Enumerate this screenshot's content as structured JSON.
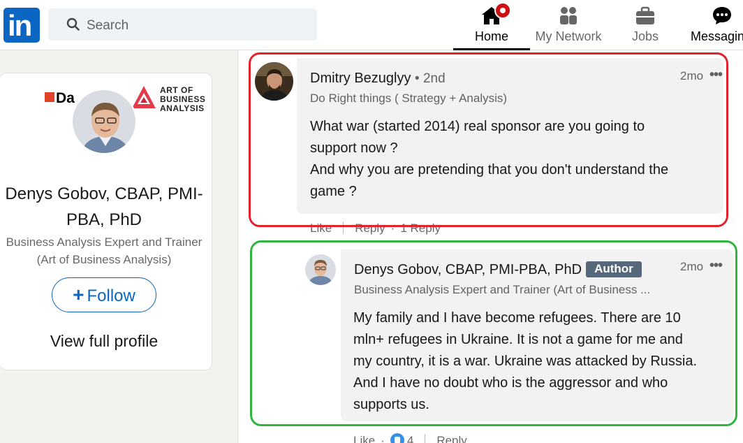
{
  "nav": {
    "logo_text": "in",
    "search_placeholder": "Search",
    "items": [
      {
        "label": "Home",
        "icon": "home-icon",
        "active": true
      },
      {
        "label": "My Network",
        "icon": "people-icon"
      },
      {
        "label": "Jobs",
        "icon": "briefcase-icon"
      },
      {
        "label": "Messaging",
        "icon": "chat-icon"
      }
    ]
  },
  "profile": {
    "brand_left": "Da",
    "brand_right": [
      "ART OF",
      "BUSINESS",
      "ANALYSIS"
    ],
    "name": "Denys Gobov, CBAP, PMI-PBA, PhD",
    "headline": "Business Analysis Expert and Trainer (Art of Business Analysis)",
    "follow_label": "Follow",
    "view_profile": "View full profile"
  },
  "comments": [
    {
      "author": "Dmitry Bezuglyy",
      "degree": "• 2nd",
      "headline": "Do Right things ( Strategy + Analysis)",
      "time": "2mo",
      "more": "•••",
      "text": [
        "What war (started 2014) real sponsor are you going to",
        "support now ?",
        "And why you are pretending that you don't understand the",
        "game ?"
      ],
      "actions": {
        "like": "Like",
        "reply": "Reply",
        "replies": "1 Reply"
      }
    },
    {
      "author": "Denys Gobov, CBAP, PMI-PBA, PhD",
      "badge": "Author",
      "headline": "Business Analysis Expert and Trainer (Art of Business ...",
      "time": "2mo",
      "more": "•••",
      "text": [
        "My family and I have become refugees. There are 10",
        "mln+ refugees in Ukraine. It is not a game for me and",
        "my country, it is a war. Ukraine was attacked by Russia.",
        "And I have no doubt who is the aggressor and who",
        "supports us."
      ],
      "actions": {
        "like": "Like",
        "like_count": "4",
        "reply": "Reply"
      }
    }
  ],
  "colors": {
    "brand": "#0a66c2",
    "highlight_red": "#e3232c",
    "highlight_green": "#2fb540",
    "notification": "#cc1016"
  }
}
